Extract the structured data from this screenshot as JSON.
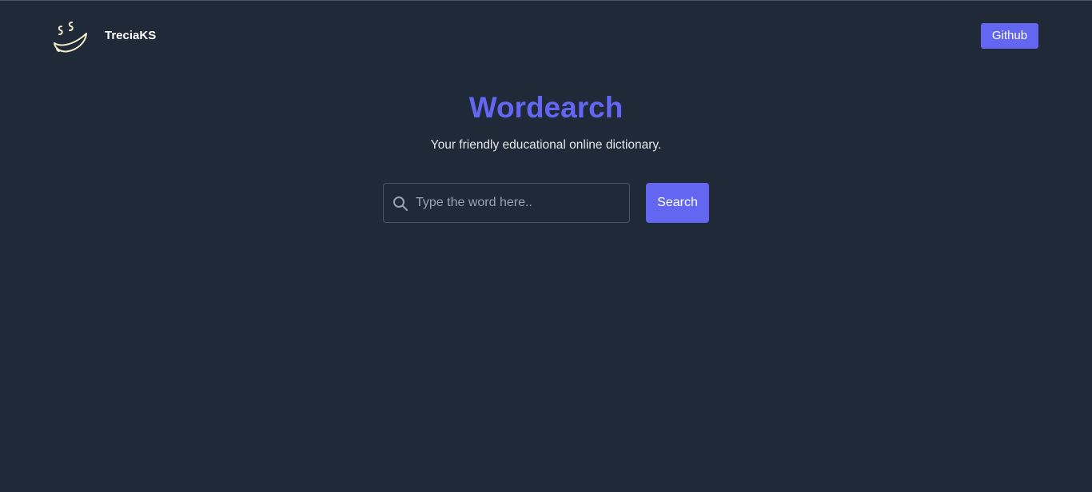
{
  "header": {
    "brand": "TreciaKS",
    "logo_icon": "steaming-bowl-icon",
    "github_label": "Github"
  },
  "hero": {
    "title": "Wordearch",
    "subtitle": "Your friendly educational online dictionary."
  },
  "search": {
    "placeholder": "Type the word here..",
    "value": "",
    "icon": "search-icon",
    "button_label": "Search"
  },
  "colors": {
    "background": "#1f2937",
    "accent": "#6366f1",
    "text": "#e5e7eb",
    "logo_stroke": "#f0eac8"
  }
}
